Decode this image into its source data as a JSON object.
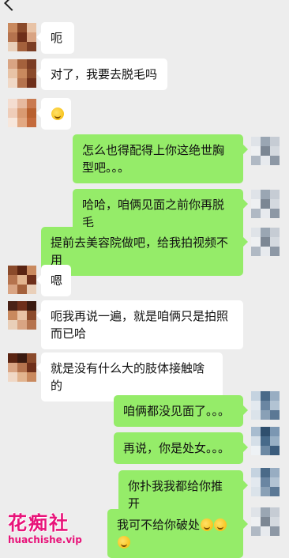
{
  "header": {
    "back_icon": "chevron-left-icon"
  },
  "colors": {
    "incoming": "#ffffff",
    "outgoing": "#95ec69",
    "background": "#ededed"
  },
  "messages": [
    {
      "dir": "in",
      "text": "呃"
    },
    {
      "dir": "in",
      "text": "对了，我要去脱毛吗"
    },
    {
      "dir": "in",
      "text": "",
      "emoji_count": 1
    },
    {
      "dir": "out",
      "text": "怎么也得配得上你这绝世胸型吧。。。"
    },
    {
      "dir": "out",
      "text": "哈哈，咱俩见面之前你再脱毛"
    },
    {
      "dir": "out",
      "text": "提前去美容院做吧，给我拍视频不用"
    },
    {
      "dir": "in",
      "text": "嗯"
    },
    {
      "dir": "in",
      "text": "呃我再说一遍，就是咱俩只是拍照而已哈"
    },
    {
      "dir": "in",
      "text": "就是没有什么大的肢体接触啥的"
    },
    {
      "dir": "out",
      "text": "咱俩都没见面了。。。"
    },
    {
      "dir": "out",
      "text": "再说，你是处女。。。"
    },
    {
      "dir": "out",
      "text": "你扑我我都给你推开"
    },
    {
      "dir": "out",
      "text": "我可不给你破处",
      "emoji_count": 3
    }
  ],
  "watermark": {
    "name": "花痴社",
    "url": "huachishe.vip"
  }
}
